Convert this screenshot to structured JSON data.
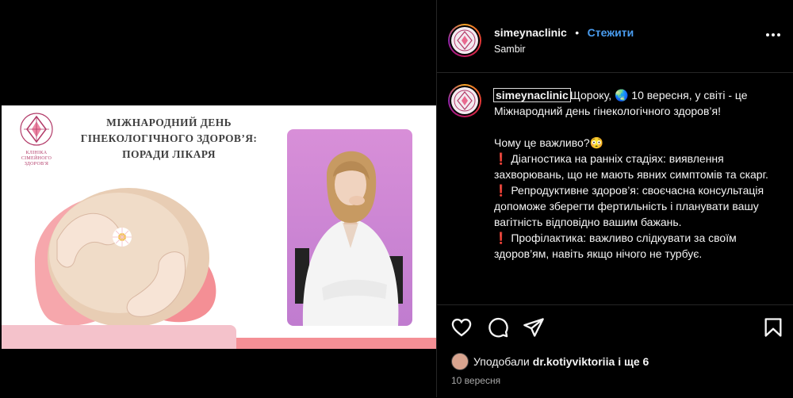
{
  "post": {
    "image": {
      "logo_lines": [
        "Клініка",
        "сімейного здоров'я"
      ],
      "headline_lines": [
        "МІЖНАРОДНИЙ ДЕНЬ",
        "ГІНЕКОЛОГІЧНОГО ЗДОРОВ’Я:",
        "ПОРАДИ ЛІКАРЯ"
      ],
      "colors": {
        "pink_light": "#f4c2cb",
        "pink_coral": "#f48f95",
        "photo_bg": "#cf8ed6",
        "logo": "#b23a68"
      }
    },
    "header": {
      "username": "simeynaclinic",
      "separator": "•",
      "follow_label": "Стежити",
      "location": "Sambir",
      "more_icon": "more-horizontal-icon"
    },
    "caption": {
      "username": "simeynaclinic",
      "lines": [
        "Щороку, 🌏 10 вересня, у світі - це Міжнародний день гінекологічного здоров’я!",
        "",
        "Чому це важливо?😳",
        "❗️ Діагностика на ранніх стадіях: виявлення захворювань, що не мають явних симптомів та скарг.",
        "❗️ Репродуктивне здоров’я: своєчасна консультація допоможе зберегти фертильність і планувати вашу вагітність відповідно вашим бажань.",
        "❗️ Профілактика: важливо слідкувати за своїм здоров’ям, навіть якщо нічого не турбує."
      ]
    },
    "actions": {
      "icons": [
        "heart-icon",
        "comment-icon",
        "share-icon",
        "bookmark-icon"
      ]
    },
    "likes": {
      "prefix": "Уподобали",
      "user": "dr.kotiyviktoriia",
      "suffix": "і ще 6"
    },
    "date": "10 вересня"
  }
}
